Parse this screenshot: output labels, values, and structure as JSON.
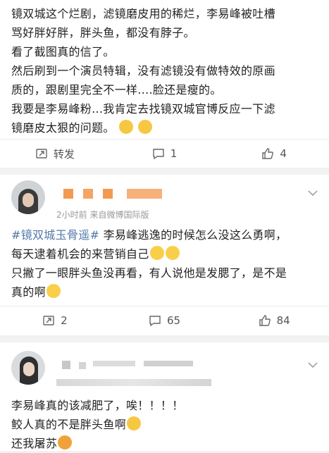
{
  "post1": {
    "lines": [
      "镜双城这个烂剧，滤镜磨皮用的稀烂，李易峰被吐槽",
      "骂好胖好胖，胖头鱼，都没有脖子。",
      "看了截图真的信了。",
      "然后刷到一个演员特辑，没有滤镜没有做特效的原画",
      "质的，跟剧里完全不一样....脸还是瘦的。",
      "我要是李易峰粉...我肯定去找镜双城官博反应一下滤",
      "镜磨皮太狠的问题。"
    ],
    "repost": "转发",
    "comments": "1",
    "likes": "4"
  },
  "post2": {
    "time_source": "2小时前  来自微博国际版",
    "hashtag": "#镜双城玉骨遥#",
    "line1_rest": " 李易峰逃逸的时候怎么没这么勇啊，",
    "line2": "每天逮着机会的来营销自己",
    "line3": "只撇了一眼胖头鱼没再看，有人说他是发腮了，是不是",
    "line4": "真的啊",
    "reposts": "2",
    "comments": "65",
    "likes": "84"
  },
  "post3": {
    "line1": "李易峰真的该减肥了，唉！！！！",
    "line2": "鲛人真的不是胖头鱼啊",
    "line3": "还我屠苏"
  },
  "colors": {
    "hashtag": "#5278a8",
    "blur_orange": "#f39a52",
    "background": "#f2f2f2"
  }
}
